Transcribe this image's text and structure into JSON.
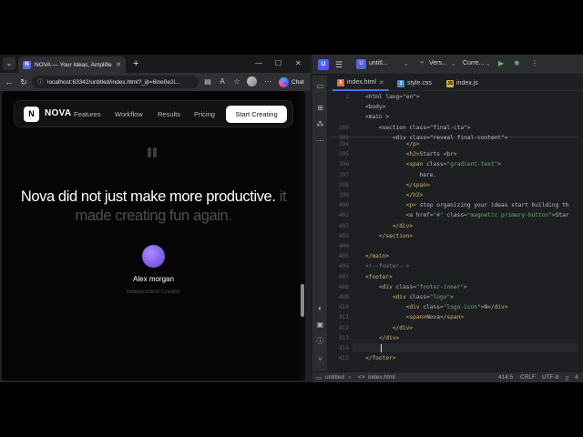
{
  "browser": {
    "tab_title": "NOVA — Your Ideas, Amplified",
    "url": "localhost:63342/untitled/index.html?_ijt=6ine0e2i...",
    "chat_label": "Chat"
  },
  "site": {
    "brand_mark": "N",
    "brand_name": "NOVA",
    "nav_links": [
      "Features",
      "Workflow",
      "Results",
      "Pricing"
    ],
    "cta_label": "Start Creating",
    "quote_bright": "Nova did not just make more productive.",
    "quote_dim_inline": "it",
    "quote_dim_line2": "made creating fun again.",
    "author_name": "Alex morgan",
    "author_role": "Independent Creator",
    "avatar_color": "#7b55e6"
  },
  "ide": {
    "logo": "IJ",
    "project_badge": "U",
    "project_name": "untitl...",
    "vcs_label": "Vers...",
    "run_config": "Curre...",
    "tabs": [
      {
        "label": "index.html",
        "kind": "html",
        "active": true
      },
      {
        "label": "style.css",
        "kind": "css",
        "active": false
      },
      {
        "label": "index.js",
        "kind": "js",
        "active": false
      }
    ],
    "sticky_lines": [
      {
        "num": "1",
        "text": "<html lang=\"en\">"
      },
      {
        "num": "",
        "text": "<body>"
      },
      {
        "num": "",
        "text": "<main >"
      },
      {
        "num": "389",
        "text": "    <section class=\"final-cta\">"
      },
      {
        "num": "391",
        "text": "        <div class=\"reveal final-content\">"
      }
    ],
    "lines": [
      {
        "num": "394",
        "text": "            </p>"
      },
      {
        "num": "395",
        "text": "            <h2>Starts <br>"
      },
      {
        "num": "396",
        "text": "            <span class=\"gradient-text\">"
      },
      {
        "num": "397",
        "text": "                here."
      },
      {
        "num": "398",
        "text": "            </span>"
      },
      {
        "num": "399",
        "text": "            </h2>"
      },
      {
        "num": "400",
        "text": "            <p> stop organizing your ideas start building th"
      },
      {
        "num": "401",
        "text": "            <a href=\"#\" class=\"magnetic primary-button\">Star"
      },
      {
        "num": "402",
        "text": "        </div>"
      },
      {
        "num": "403",
        "text": "    </section>"
      },
      {
        "num": "404",
        "text": ""
      },
      {
        "num": "405",
        "text": "</main>"
      },
      {
        "num": "406",
        "text": "<!--footer-->"
      },
      {
        "num": "407",
        "text": "<footer>"
      },
      {
        "num": "408",
        "text": "    <div class=\"footer-inner\">"
      },
      {
        "num": "409",
        "text": "        <div class=\"logo\">"
      },
      {
        "num": "410",
        "text": "            <div class=\"logo-icon\">N</div>"
      },
      {
        "num": "411",
        "text": "            <span>Nova</span>"
      },
      {
        "num": "412",
        "text": "        </div>"
      },
      {
        "num": "413",
        "text": "    </div>"
      },
      {
        "num": "414",
        "text": ""
      },
      {
        "num": "415",
        "text": "</footer>"
      }
    ],
    "status": {
      "breadcrumb_project": "untitled",
      "breadcrumb_file": "index.html",
      "position": "414:5",
      "line_sep": "CRLF",
      "encoding": "UTF-8",
      "indent": "4"
    }
  }
}
